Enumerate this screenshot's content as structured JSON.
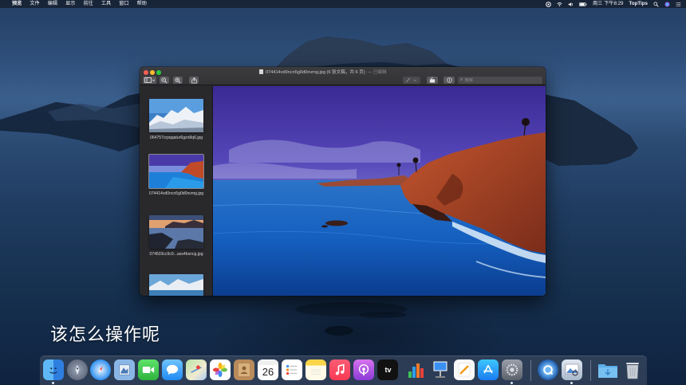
{
  "menubar": {
    "apple_glyph": "",
    "items": [
      "预览",
      "文件",
      "编辑",
      "显示",
      "前往",
      "工具",
      "窗口",
      "帮助"
    ],
    "clock": "周三 下午8:29",
    "user": "TopTips"
  },
  "window": {
    "title": "074414vd0ncn5g0d0nvmg.jpg (6 张文稿，共 6 页)",
    "edited": "— 已编辑",
    "search_placeholder": "搜索",
    "icons": {
      "sidebar": "sidebar-icon",
      "zoom_out": "zoom-out-icon",
      "zoom_in": "zoom-in-icon",
      "share": "share-icon",
      "markup": "markup-pen-icon",
      "rotate": "rotate-icon",
      "annotate": "annotate-icon"
    },
    "thumbnails": [
      {
        "caption": "064757crpqqatur6gzn8q6.jpg"
      },
      {
        "caption": "074414vd0ncn5g0d0nvmg.jpg"
      },
      {
        "caption": "074503cc9c9...ass4bsncg.jpg"
      },
      {
        "caption": ""
      }
    ]
  },
  "subtitle": "该怎么操作呢",
  "dock": {
    "calendar_day": "26",
    "tv_label": "tv",
    "apps": [
      "Finder",
      "Launchpad",
      "Safari",
      "Mail",
      "FaceTime",
      "Messages",
      "Maps",
      "Photos",
      "Contacts",
      "Calendar",
      "Reminders",
      "Notes",
      "Music",
      "Podcasts",
      "TV",
      "Numbers",
      "Keynote",
      "Pages",
      "App Store",
      "System Preferences",
      "QuickTime",
      "Preview",
      "Downloads",
      "Trash"
    ]
  },
  "colors": {
    "close": "#fe5f57",
    "minimize": "#febc2e",
    "zoom": "#28c840"
  }
}
